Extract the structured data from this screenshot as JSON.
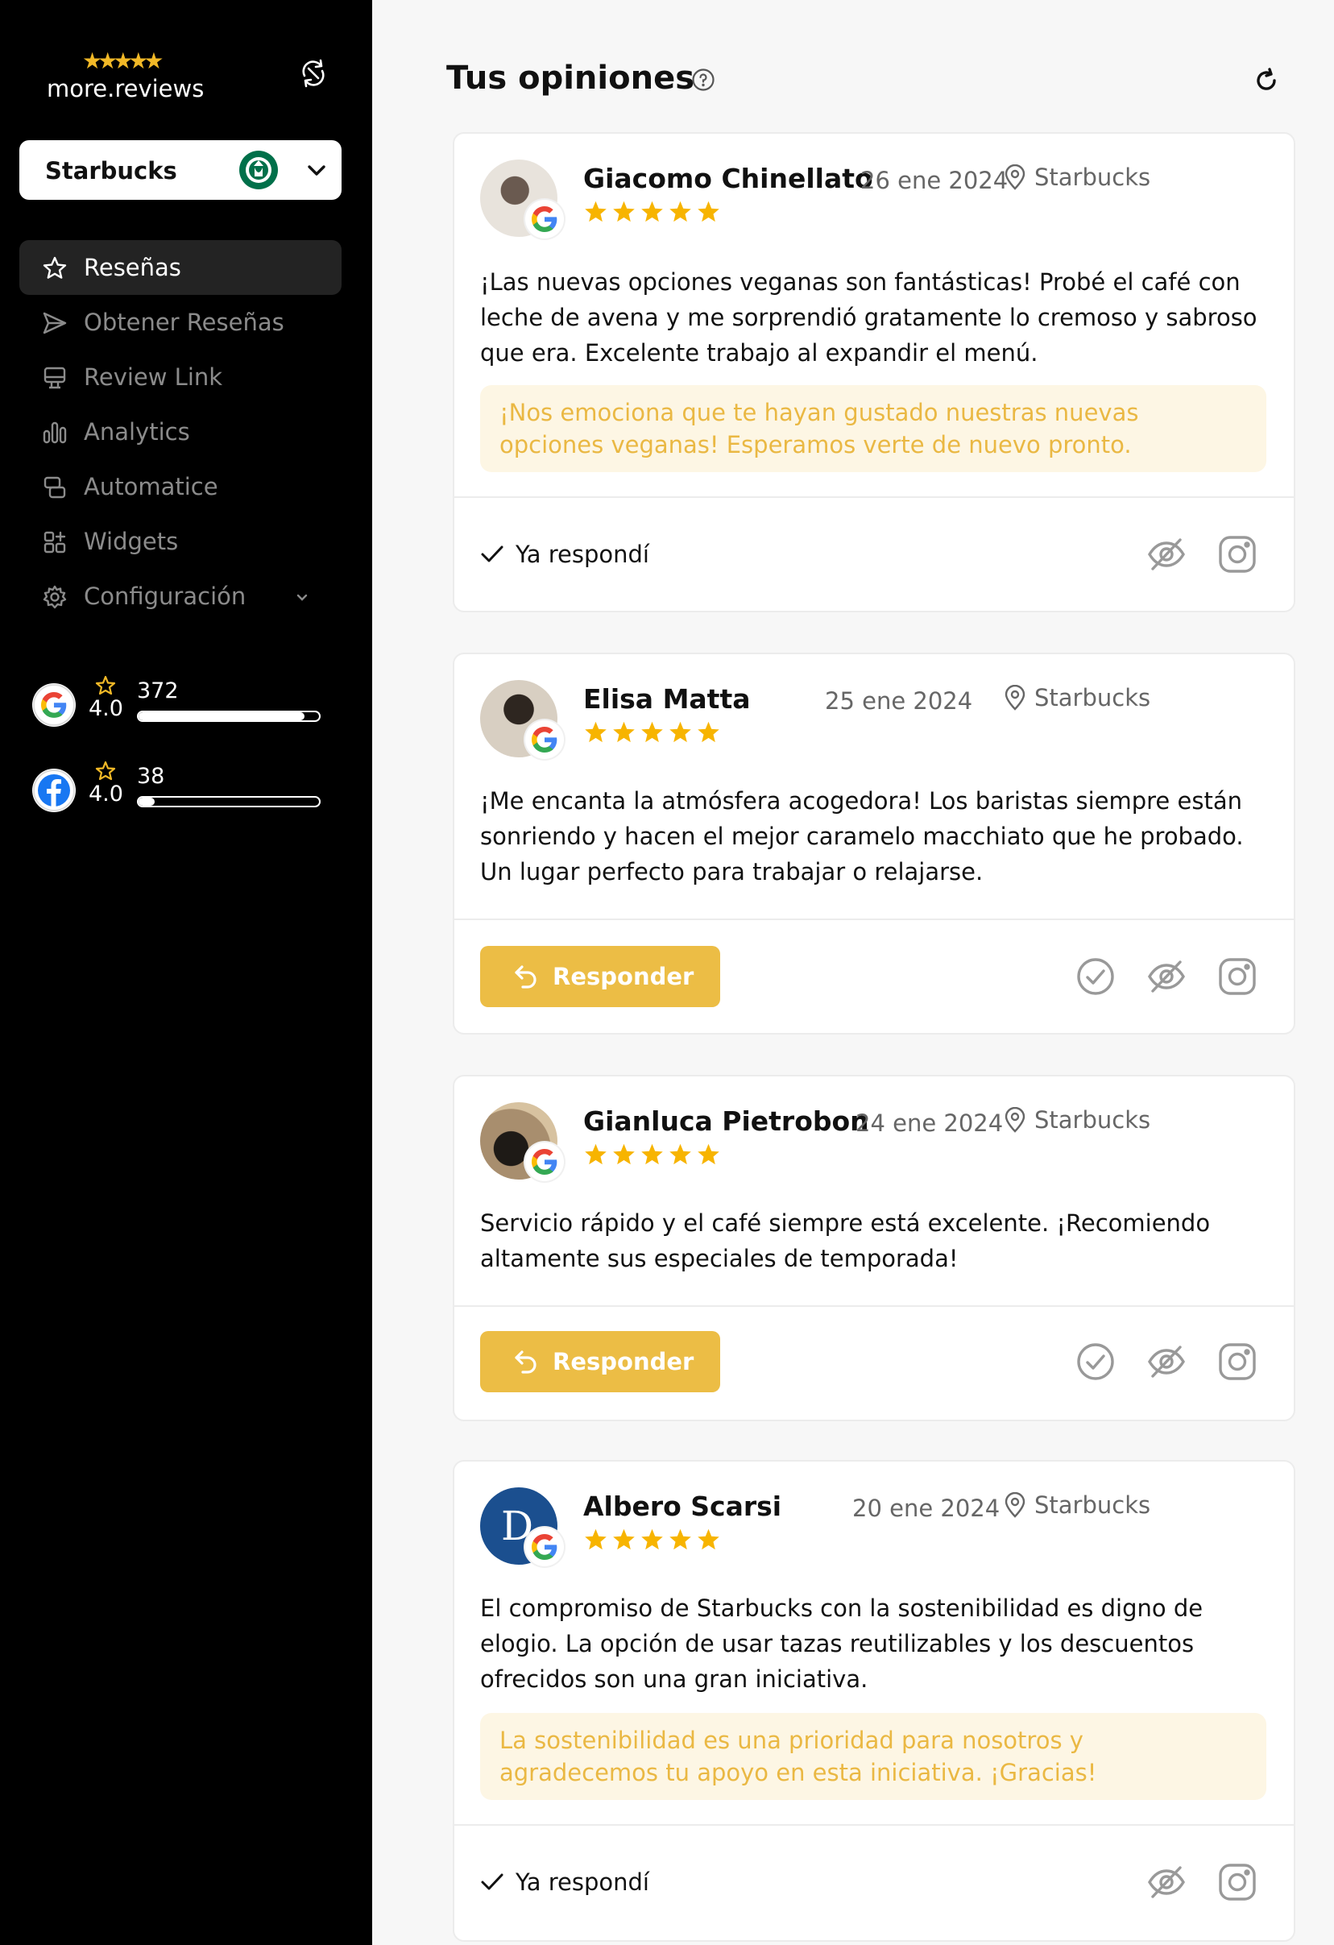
{
  "brand": {
    "name": "more.reviews",
    "stars": "★★★★★",
    "accent": "#ecbd45"
  },
  "business": {
    "name": "Starbucks"
  },
  "nav": [
    {
      "label": "Reseñas",
      "icon": "star-icon",
      "active": true
    },
    {
      "label": "Obtener Reseñas",
      "icon": "send-icon"
    },
    {
      "label": "Review Link",
      "icon": "monitor-icon"
    },
    {
      "label": "Analytics",
      "icon": "bar-chart-icon"
    },
    {
      "label": "Automatice",
      "icon": "automation-icon"
    },
    {
      "label": "Widgets",
      "icon": "widgets-icon"
    },
    {
      "label": "Configuración",
      "icon": "gear-icon"
    }
  ],
  "stats": [
    {
      "platform": "Google",
      "rating": "4.0",
      "count": "372",
      "fill": 0.92
    },
    {
      "platform": "Facebook",
      "rating": "4.0",
      "count": "38",
      "fill": 0.06
    }
  ],
  "page": {
    "title": "Tus opiniones"
  },
  "reviews": [
    {
      "author": "Giacomo Chinellato",
      "date": "26 ene 2024",
      "location": "Starbucks",
      "rating": 5,
      "text": "¡Las nuevas opciones veganas son fantásticas! Probé el café con leche de avena y me sorprendió gratamente lo cremoso y sabroso que era. Excelente trabajo al expandir el menú.",
      "reply": "¡Nos emociona que te hayan gustado nuestras nuevas opciones veganas! Esperamos verte de nuevo pronto.",
      "answered_label": "Ya respondí"
    },
    {
      "author": "Elisa Matta",
      "date": "25 ene 2024",
      "location": "Starbucks",
      "rating": 5,
      "text": "¡Me encanta la atmósfera acogedora! Los baristas siempre están sonriendo y hacen el mejor caramelo macchiato que he probado. Un lugar perfecto para trabajar o relajarse.",
      "respond_label": "Responder"
    },
    {
      "author": "Gianluca Pietrobon",
      "date": "24 ene 2024",
      "location": "Starbucks",
      "rating": 5,
      "text": "Servicio rápido y el café siempre está excelente. ¡Recomiendo altamente sus especiales de temporada!",
      "respond_label": "Responder"
    },
    {
      "author": "Albero Scarsi",
      "date": "20 ene 2024",
      "location": "Starbucks",
      "rating": 5,
      "avatar_letter": "D",
      "text": "El compromiso de Starbucks con la sostenibilidad es digno de elogio. La opción de usar tazas reutilizables y los descuentos ofrecidos son una gran iniciativa.",
      "reply": "La sostenibilidad es una prioridad para nosotros y agradecemos tu apoyo en esta iniciativa. ¡Gracias!",
      "answered_label": "Ya respondí"
    }
  ]
}
